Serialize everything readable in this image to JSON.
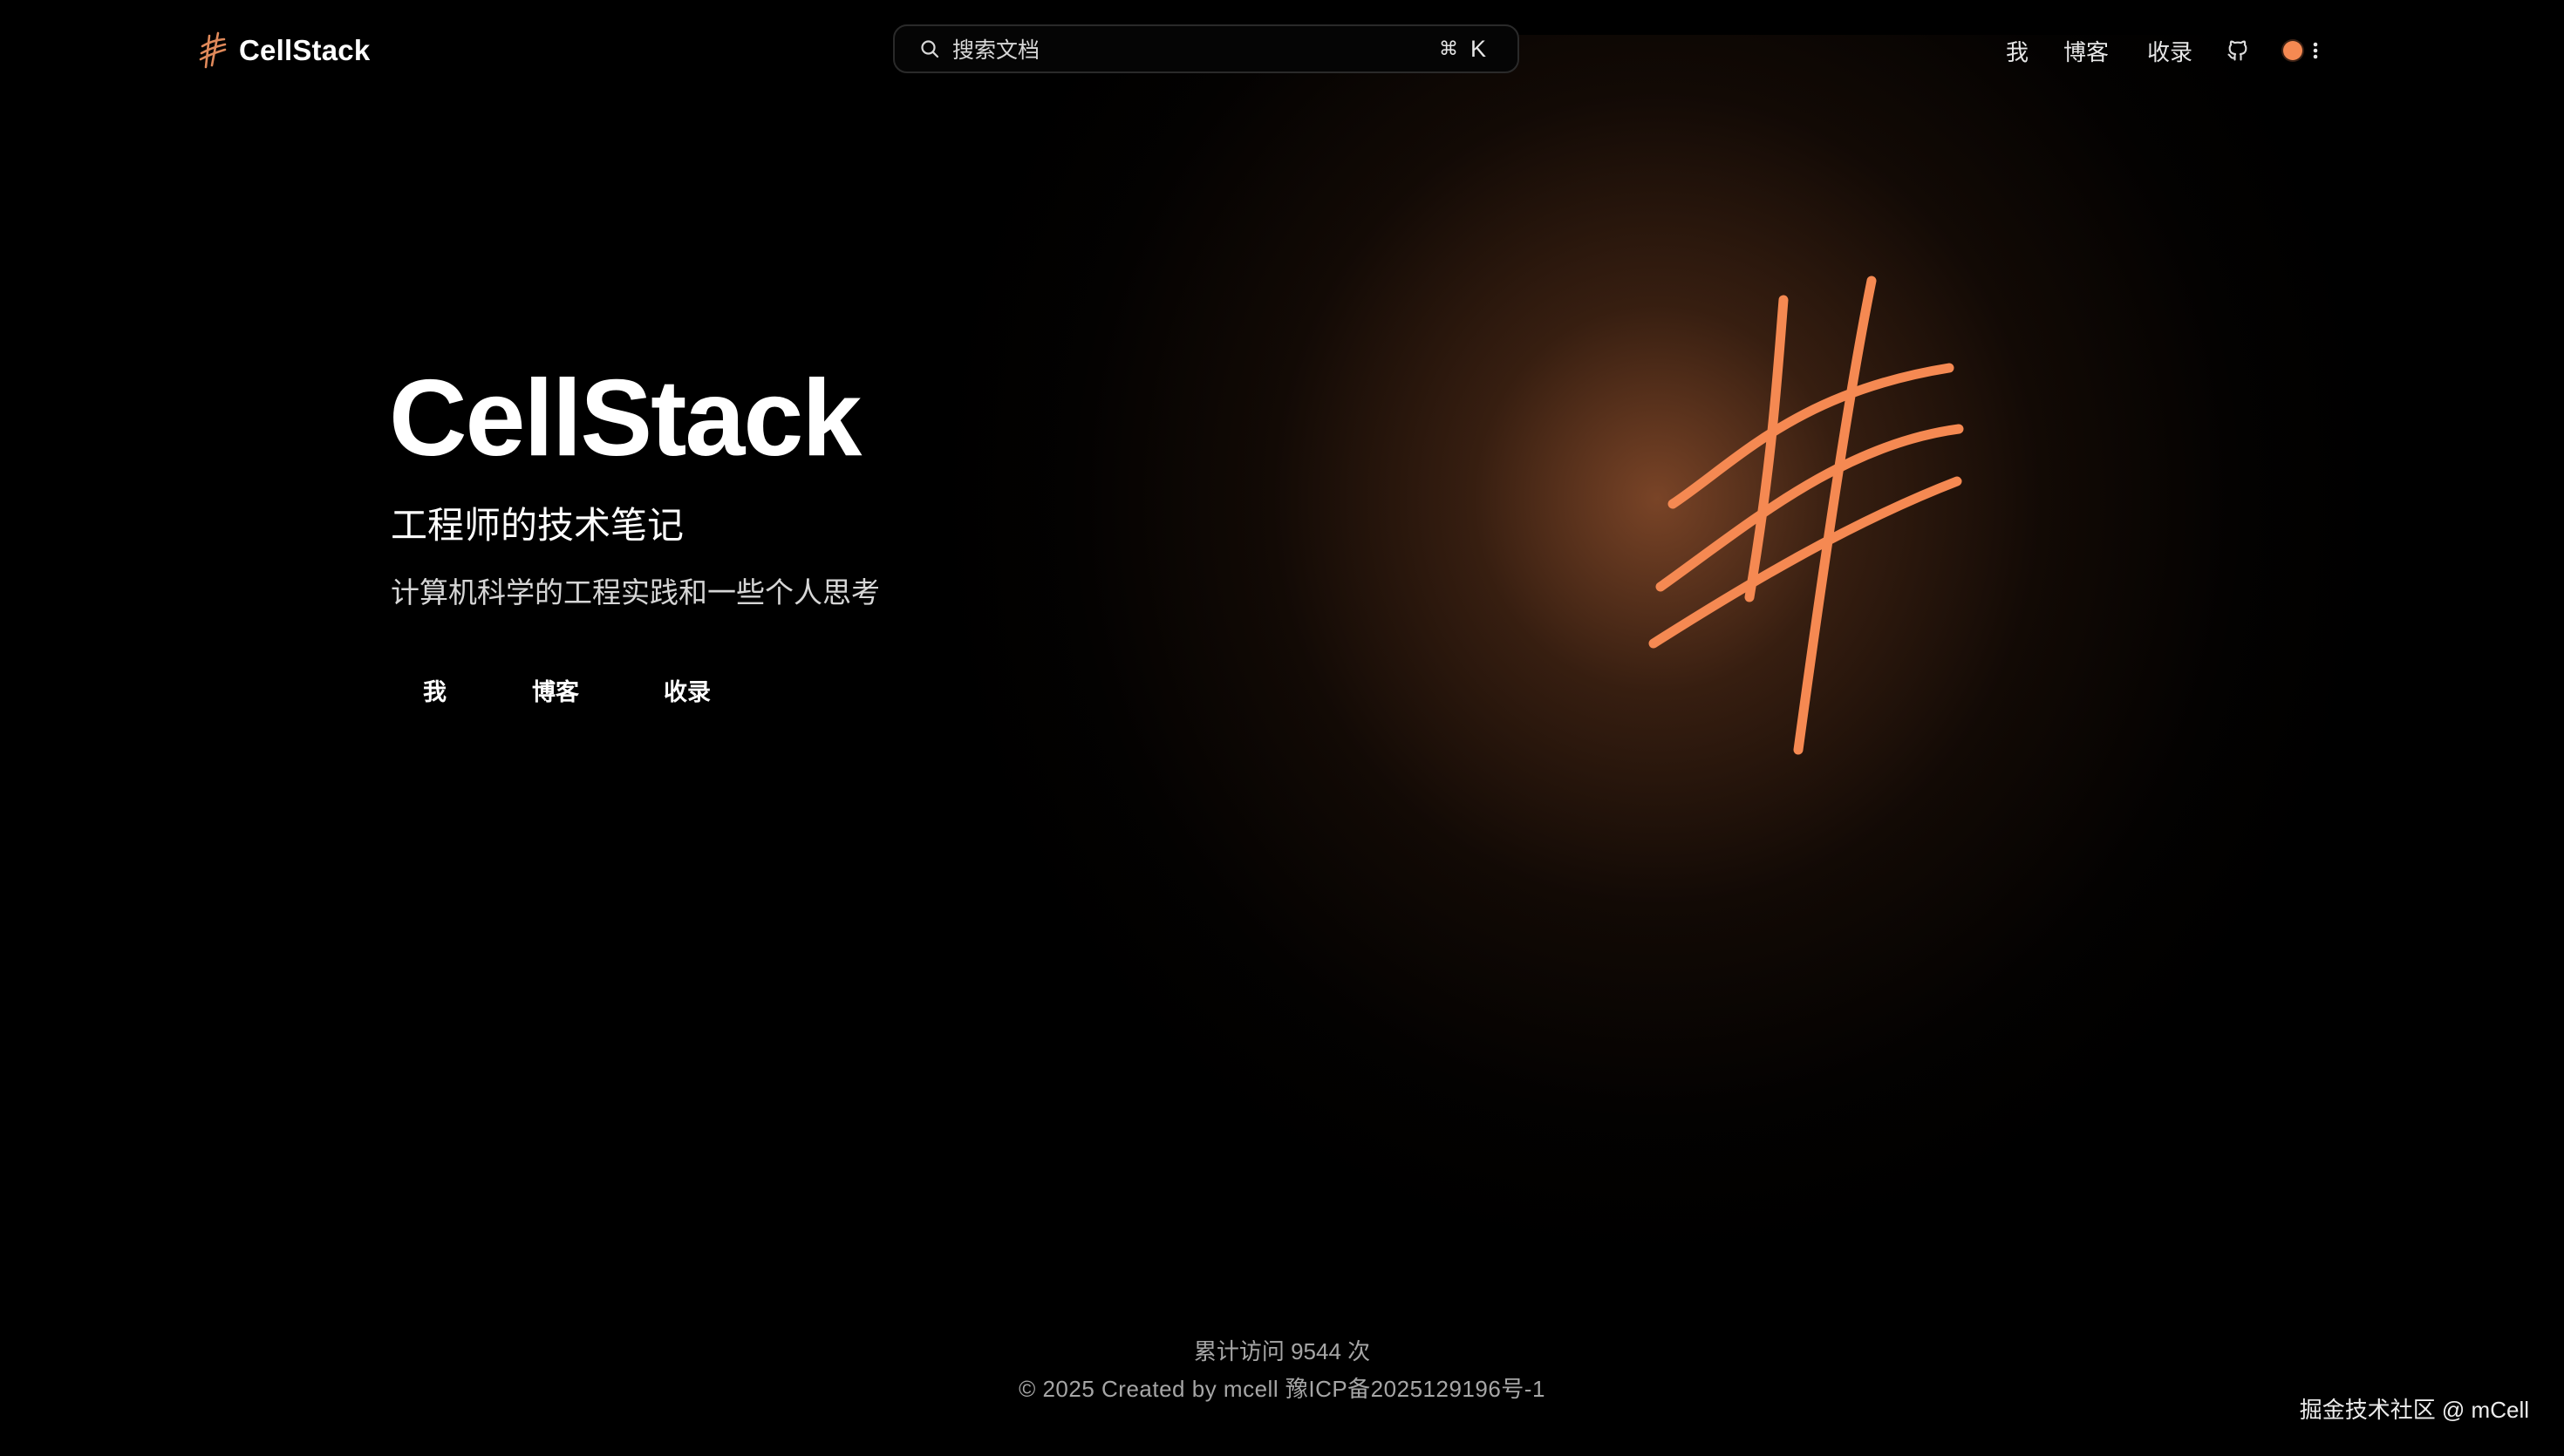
{
  "navbar": {
    "brand": "CellStack",
    "search_placeholder": "搜索文档",
    "shortcut_modifier": "⌘",
    "shortcut_key": "K",
    "links": [
      "我",
      "博客",
      "收录"
    ],
    "icons": [
      "github-icon",
      "theme-toggle",
      "more-vertical-icon"
    ]
  },
  "hero": {
    "title": "CellStack",
    "subtitle": "工程师的技术笔记",
    "description": "计算机科学的工程实践和一些个人思考",
    "actions": [
      "我",
      "博客",
      "收录"
    ]
  },
  "footer": {
    "visits": "累计访问 9544 次",
    "copyright": "© 2025 Created by mcell",
    "icp": "豫ICP备2025129196号-1"
  },
  "watermark": "掘金技术社区 @ mCell",
  "colors": {
    "background": "#000000",
    "accent": "#f58952",
    "glow": "#a85e36",
    "text_muted": "#a6a6a6"
  }
}
